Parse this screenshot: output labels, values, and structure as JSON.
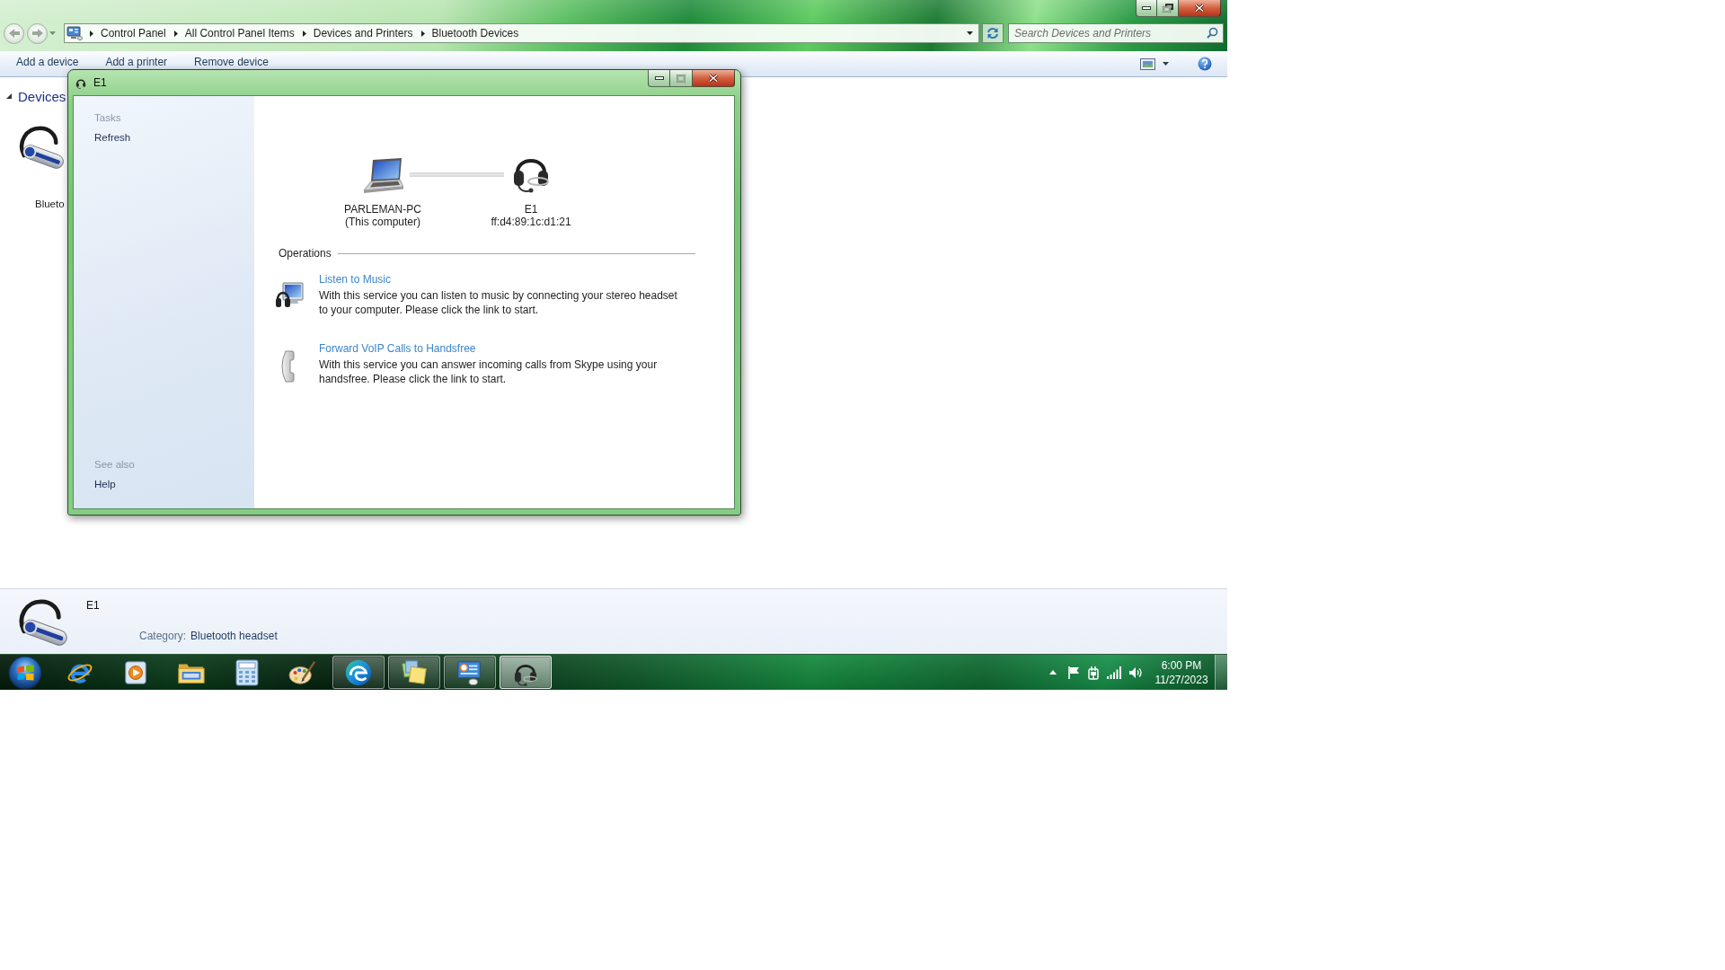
{
  "explorer": {
    "address_bar": {
      "breadcrumbs": [
        "Control Panel",
        "All Control Panel Items",
        "Devices and Printers",
        "Bluetooth Devices"
      ]
    },
    "search": {
      "placeholder": "Search Devices and Printers"
    },
    "toolbar": {
      "buttons": [
        "Add a device",
        "Add a printer",
        "Remove device"
      ]
    },
    "devices_group": {
      "title": "Devices",
      "expanded": true,
      "items": [
        {
          "label": "Blueto"
        }
      ]
    },
    "details_pane": {
      "name": "E1",
      "category_label": "Category:",
      "category": "Bluetooth headset"
    }
  },
  "dialog": {
    "title": "E1",
    "sidebar": {
      "sections": [
        {
          "heading": "Tasks",
          "links": [
            "Refresh"
          ]
        },
        {
          "heading": "See also",
          "links": [
            "Help"
          ]
        }
      ]
    },
    "connection": {
      "computer": {
        "name": "PARLEMAN-PC",
        "note": "(This computer)"
      },
      "device": {
        "name": "E1",
        "address": "ff:d4:89:1c:d1:21"
      }
    },
    "operations": {
      "heading": "Operations",
      "items": [
        {
          "kind": "music",
          "link": "Listen to Music",
          "description": "With this service you can listen to music by connecting your stereo headset to your computer. Please click the link to start."
        },
        {
          "kind": "phone",
          "link": "Forward VoIP Calls to Handsfree",
          "description": "With this service you can answer incoming calls from Skype using your handsfree. Please click the link to start."
        }
      ]
    }
  },
  "taskbar": {
    "apps": [
      {
        "kind": "ie",
        "running": false,
        "selected": false
      },
      {
        "kind": "player",
        "running": false,
        "selected": false
      },
      {
        "kind": "explorer",
        "running": false,
        "selected": false
      },
      {
        "kind": "calculator",
        "running": false,
        "selected": false
      },
      {
        "kind": "paint",
        "running": false,
        "selected": false
      },
      {
        "kind": "edge",
        "running": true,
        "selected": false
      },
      {
        "kind": "notes",
        "running": true,
        "selected": false
      },
      {
        "kind": "control_panel",
        "running": true,
        "selected": false
      },
      {
        "kind": "bluetooth",
        "running": true,
        "selected": true
      }
    ],
    "clock": {
      "time": "6:00 PM",
      "date": "11/27/2023"
    }
  }
}
